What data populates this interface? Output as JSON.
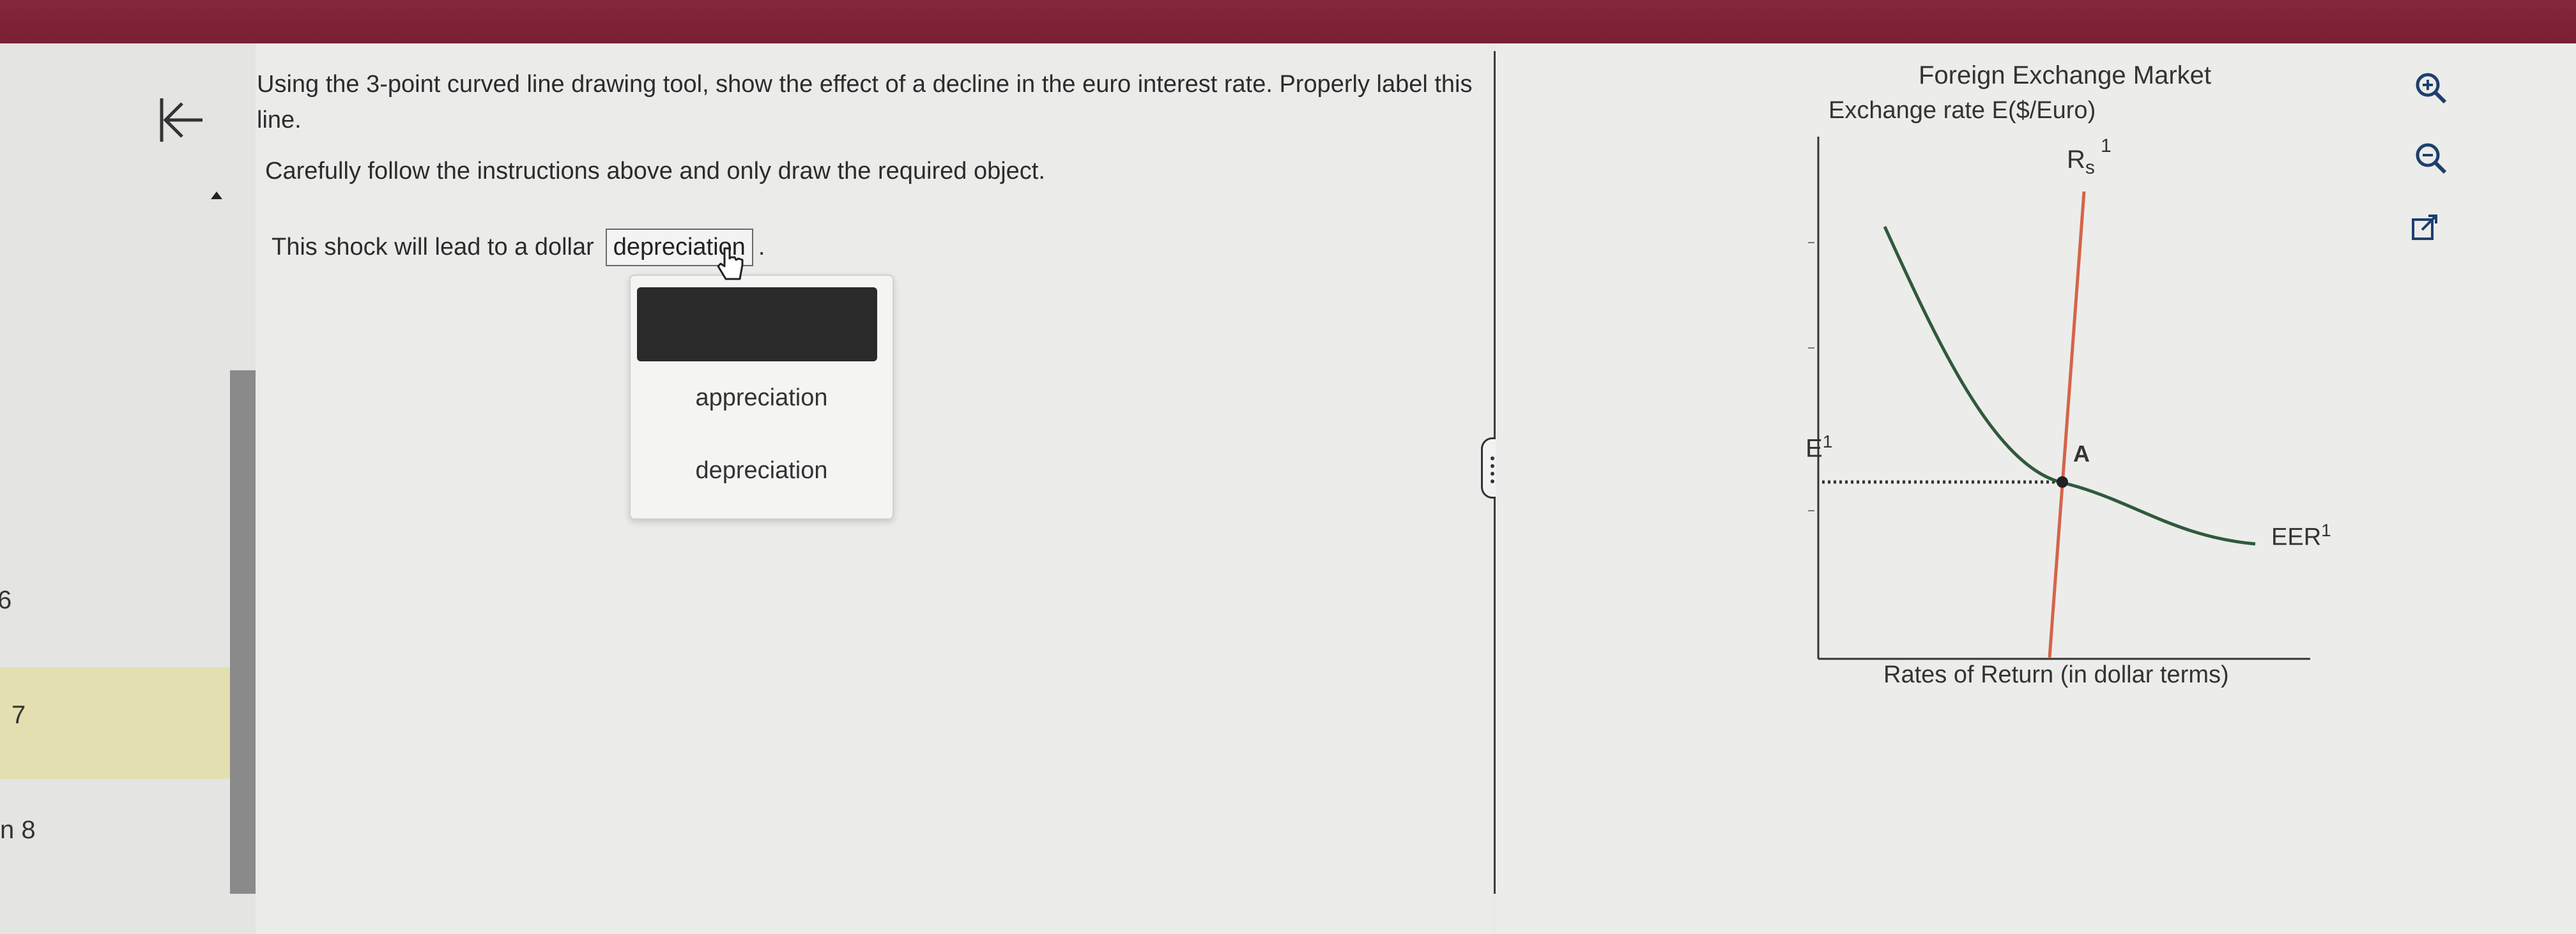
{
  "nav": {
    "items": [
      {
        "label": "6"
      },
      {
        "label": "7"
      },
      {
        "label": "n 8"
      }
    ]
  },
  "question": {
    "instruction": "Using the 3-point curved line drawing tool, show the effect of a decline in the euro interest rate. Properly label this line.",
    "caution": "Carefully follow the instructions above and only draw the required object.",
    "shock_prefix": "This shock will lead to a dollar",
    "selected_value": "depreciation",
    "shock_suffix": ".",
    "dropdown_options": [
      "appreciation",
      "depreciation"
    ]
  },
  "graph": {
    "title": "Foreign Exchange Market",
    "y_axis_label": "Exchange rate E($/Euro)",
    "x_axis_label": "Rates of Return (in dollar terms)",
    "rs_label": "R",
    "rs_sub": "s",
    "rs_sup": "1",
    "eer_label": "EER",
    "eer_sup": "1",
    "e_label": "E",
    "e_sup": "1",
    "point_label": "A",
    "colors": {
      "rs_line": "#d4644a",
      "eer_curve": "#2f5a3c",
      "axis": "#333333"
    }
  },
  "tools": {
    "zoom_in": "zoom-in-icon",
    "zoom_out": "zoom-out-icon",
    "popout": "external-link-icon"
  }
}
